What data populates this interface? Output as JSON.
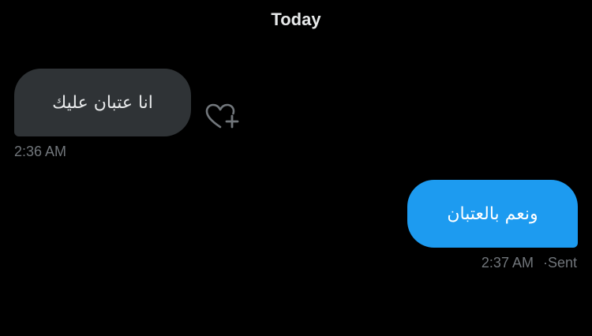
{
  "conversation": {
    "date_header": "Today",
    "messages": [
      {
        "direction": "received",
        "text": "انا عتبان عليك",
        "time": "2:36 AM"
      },
      {
        "direction": "sent",
        "text": "ونعم بالعتبان",
        "time": "2:37 AM",
        "separator": "·",
        "status": "Sent"
      }
    ]
  },
  "icons": {
    "add_reaction": "heart-plus-icon"
  },
  "colors": {
    "background": "#000000",
    "received_bubble": "#2f3336",
    "sent_bubble": "#1d9bf0",
    "meta_text": "#71767b",
    "primary_text": "#e7e9ea"
  }
}
